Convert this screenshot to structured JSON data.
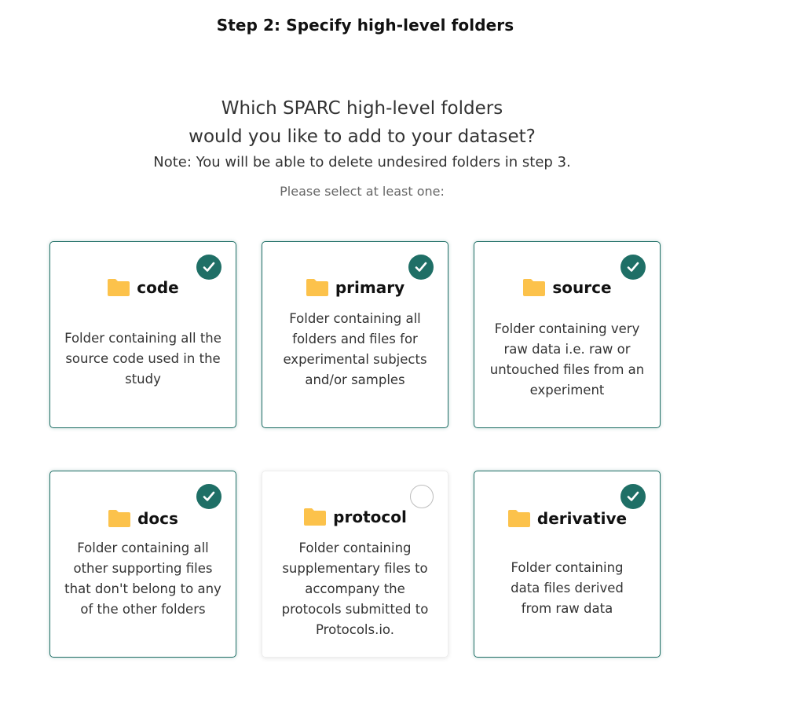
{
  "header": {
    "step_title": "Step 2: Specify high-level folders"
  },
  "prompt": {
    "question_line1": "Which SPARC high-level folders",
    "question_line2": "would you like to add to your dataset?",
    "note": "Note: You will be able to delete undesired folders in step 3.",
    "hint": "Please select at least one:"
  },
  "colors": {
    "accent": "#1f6f66",
    "folder": "#fcc24b"
  },
  "folders": [
    {
      "name": "code",
      "selected": true,
      "description": "Folder containing all the source code used in the study"
    },
    {
      "name": "primary",
      "selected": true,
      "description": "Folder containing all folders and files for experimental subjects and/or samples"
    },
    {
      "name": "source",
      "selected": true,
      "description": "Folder containing very raw data i.e. raw or untouched files from an experiment"
    },
    {
      "name": "docs",
      "selected": true,
      "description": "Folder containing all other supporting files that don't belong to any of the other folders"
    },
    {
      "name": "protocol",
      "selected": false,
      "description": "Folder containing supplementary files to accompany the protocols submitted to Protocols.io."
    },
    {
      "name": "derivative",
      "selected": true,
      "description": "Folder containing data files derived from raw data"
    }
  ]
}
